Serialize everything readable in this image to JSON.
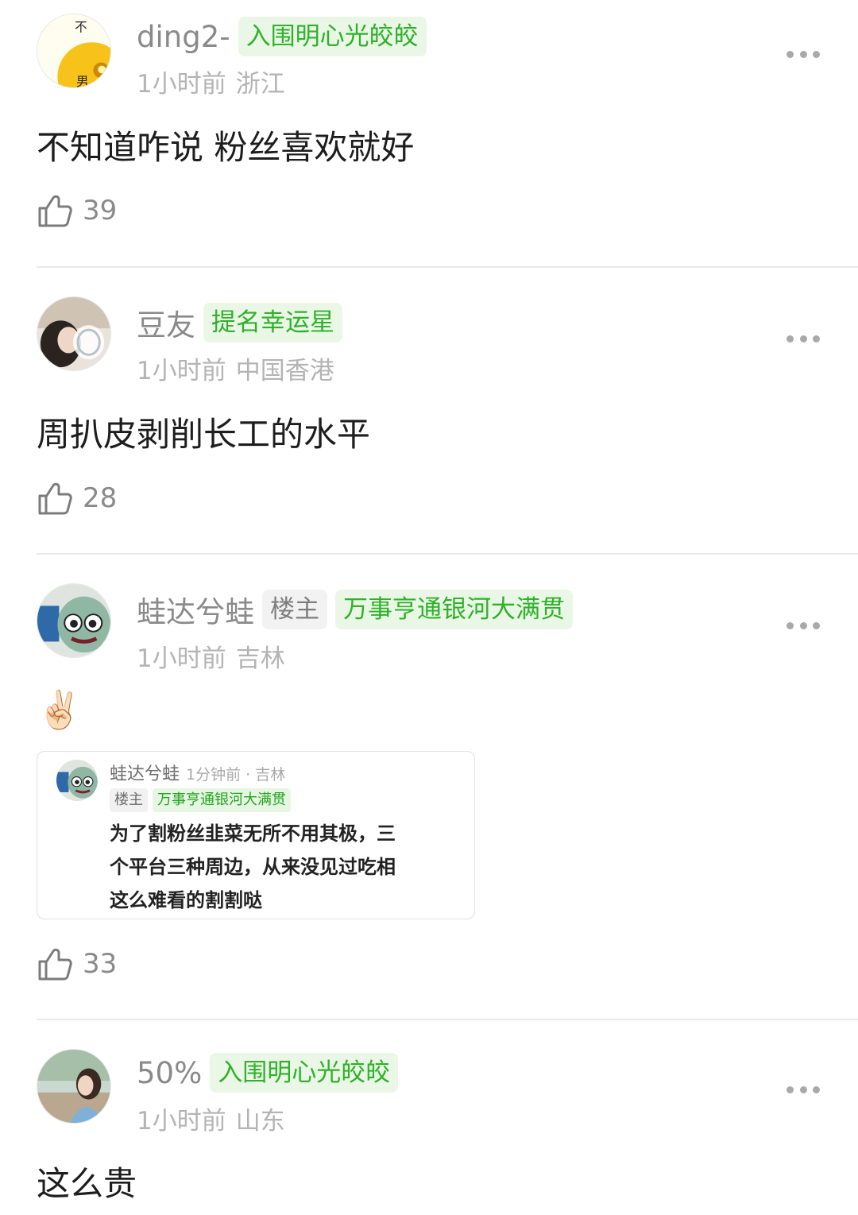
{
  "comments": [
    {
      "username": "ding2-",
      "badges": [
        "入围明心光皎皎"
      ],
      "time": "1小时前",
      "location": "浙江",
      "text": "不知道咋说 粉丝喜欢就好",
      "likes": "39"
    },
    {
      "username": "豆友",
      "badges": [
        "提名幸运星"
      ],
      "time": "1小时前",
      "location": "中国香港",
      "text": "周扒皮剥削长工的水平",
      "likes": "28"
    },
    {
      "username": "蛙达兮蛙",
      "op_label": "楼主",
      "badges": [
        "万事亨通银河大满贯"
      ],
      "time": "1小时前",
      "location": "吉林",
      "text": "✌🏻",
      "likes": "33",
      "quote": {
        "username": "蛙达兮蛙",
        "time": "1分钟前 · 吉林",
        "op_label": "楼主",
        "badge": "万事亨通银河大满贯",
        "lines": [
          "为了割粉丝韭菜无所不用其极，三",
          "个平台三种周边，从来没见过吃相",
          "这么难看的割割哒"
        ]
      }
    },
    {
      "username": "50%",
      "badges": [
        "入围明心光皎皎"
      ],
      "time": "1小时前",
      "location": "山东",
      "text": "这么贵"
    }
  ],
  "icons": {
    "more": "more-dots-icon",
    "like": "thumbs-up-icon"
  }
}
